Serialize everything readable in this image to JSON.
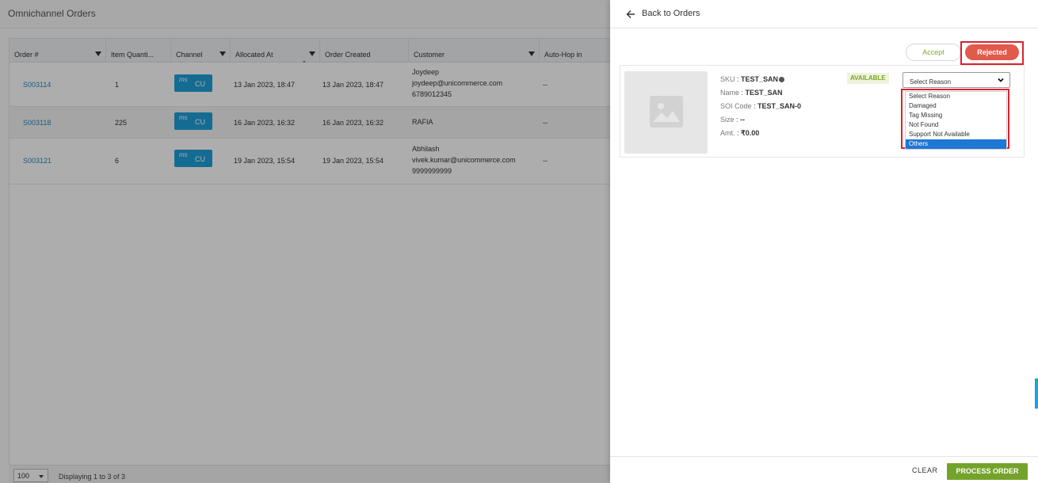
{
  "page": {
    "title": "Omnichannel Orders"
  },
  "grid": {
    "columns": [
      "Order #",
      "Item Quanti...",
      "Channel",
      "Allocated At",
      "Order Created",
      "Customer",
      "Auto-Hop in"
    ],
    "rows": [
      {
        "order": "S003114",
        "qty": "1",
        "channel_ms": "ms",
        "channel_cu": "CU",
        "allocated": "13 Jan 2023, 18:47",
        "created": "13 Jan 2023, 18:47",
        "customer": [
          "Joydeep",
          "joydeep@unicommerce.com",
          "6789012345"
        ],
        "autohop": "--"
      },
      {
        "order": "S003118",
        "qty": "225",
        "channel_ms": "ms",
        "channel_cu": "CU",
        "allocated": "16 Jan 2023, 16:32",
        "created": "16 Jan 2023, 16:32",
        "customer": [
          "RAFIA"
        ],
        "autohop": "--"
      },
      {
        "order": "S003121",
        "qty": "6",
        "channel_ms": "ms",
        "channel_cu": "CU",
        "allocated": "19 Jan 2023, 15:54",
        "created": "19 Jan 2023, 15:54",
        "customer": [
          "Abhilash",
          "vivek.kumar@unicommerce.com",
          "9999999999"
        ],
        "autohop": "--"
      }
    ],
    "footer": {
      "page_size": "100",
      "displaying": "Displaying 1 to 3 of 3"
    }
  },
  "panel": {
    "back_label": "Back to Orders",
    "accept_label": "Accept",
    "rejected_label": "Rejected",
    "item": {
      "sku_key": "SKU",
      "sku_value": "TEST_SAN",
      "name_key": "Name",
      "name_value": "TEST_SAN",
      "soi_key": "SOI Code",
      "soi_value": "TEST_SAN-0",
      "size_key": "Size",
      "size_value": "--",
      "amt_key": "Amt.",
      "amt_value": "₹0.00",
      "availability": "AVAILABLE"
    },
    "reason": {
      "selected": "Select Reason",
      "options": [
        "Select Reason",
        "Damaged",
        "Tag Missing",
        "Not Found",
        "Support Not Available",
        "Others"
      ],
      "highlighted": "Others"
    },
    "clear_label": "CLEAR",
    "process_label": "PROCESS ORDER"
  },
  "colors": {
    "accent_green": "#74a32b",
    "rejected_red": "#e25a4c",
    "link_blue": "#2b86c5",
    "channel_blue": "#1fa0d8",
    "highlight_border": "#d9232d"
  }
}
